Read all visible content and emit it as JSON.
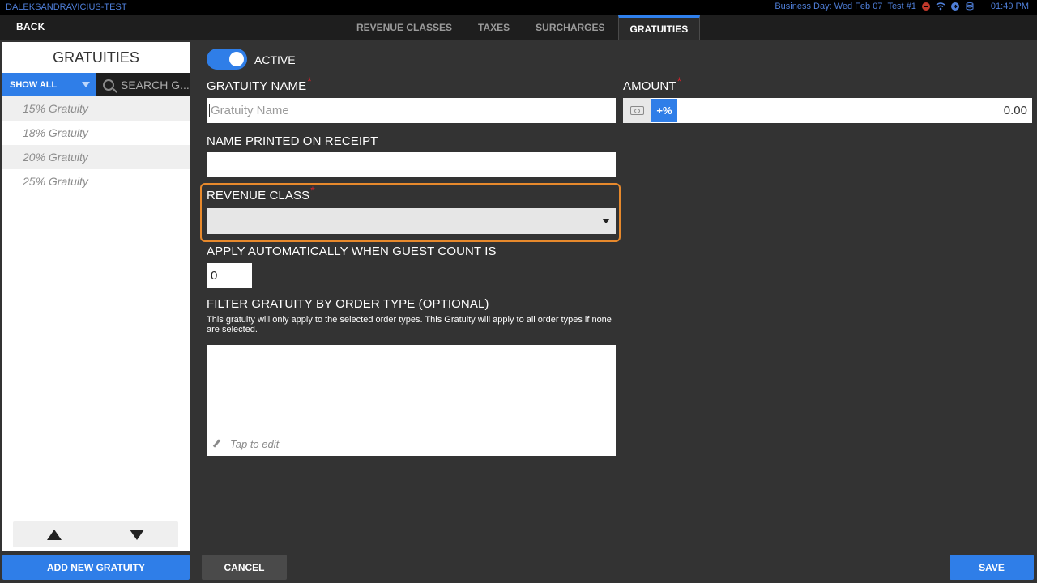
{
  "status_bar": {
    "device_name": "DALEKSANDRAVICIUS-TEST",
    "business_day": "Business Day: Wed Feb 07",
    "terminal": "Test  #1",
    "time": "01:49 PM",
    "accent_color": "#4f7fd9"
  },
  "nav": {
    "back_label": "BACK",
    "tabs": [
      {
        "label": "REVENUE CLASSES",
        "active": false
      },
      {
        "label": "TAXES",
        "active": false
      },
      {
        "label": "SURCHARGES",
        "active": false
      },
      {
        "label": "GRATUITIES",
        "active": true
      }
    ]
  },
  "sidebar": {
    "title": "GRATUITIES",
    "filter_label": "SHOW ALL",
    "search_placeholder": "SEARCH G...",
    "items": [
      {
        "label": "15% Gratuity"
      },
      {
        "label": "18% Gratuity"
      },
      {
        "label": "20% Gratuity"
      },
      {
        "label": "25% Gratuity"
      }
    ],
    "up_icon": "arrow-up-icon",
    "down_icon": "arrow-down-icon"
  },
  "form": {
    "active_label": "ACTIVE",
    "active_on": true,
    "gratuity_name": {
      "label": "GRATUITY NAME",
      "required_mark": "*",
      "value": "",
      "placeholder": "Gratuity Name"
    },
    "amount": {
      "label": "AMOUNT",
      "required_mark": "*",
      "percent_button": "+%",
      "value": "0.00"
    },
    "receipt_name": {
      "label": "NAME PRINTED ON RECEIPT",
      "value": ""
    },
    "revenue_class": {
      "label": "REVENUE CLASS",
      "required_mark": "*",
      "selected": ""
    },
    "guest_count": {
      "label": "APPLY AUTOMATICALLY WHEN GUEST COUNT IS",
      "value": "0"
    },
    "order_type_filter": {
      "label": "FILTER GRATUITY BY ORDER TYPE (OPTIONAL)",
      "help": "This gratuity will only apply to the selected order types. This Gratuity will apply to all order types if none are selected.",
      "tap_to_edit": "Tap to edit"
    }
  },
  "buttons": {
    "add_new": "ADD NEW GRATUITY",
    "cancel": "CANCEL",
    "save": "SAVE"
  },
  "colors": {
    "primary": "#2f7ee8",
    "highlight": "#e7892c",
    "required": "#d4252c",
    "background": "#333333"
  }
}
